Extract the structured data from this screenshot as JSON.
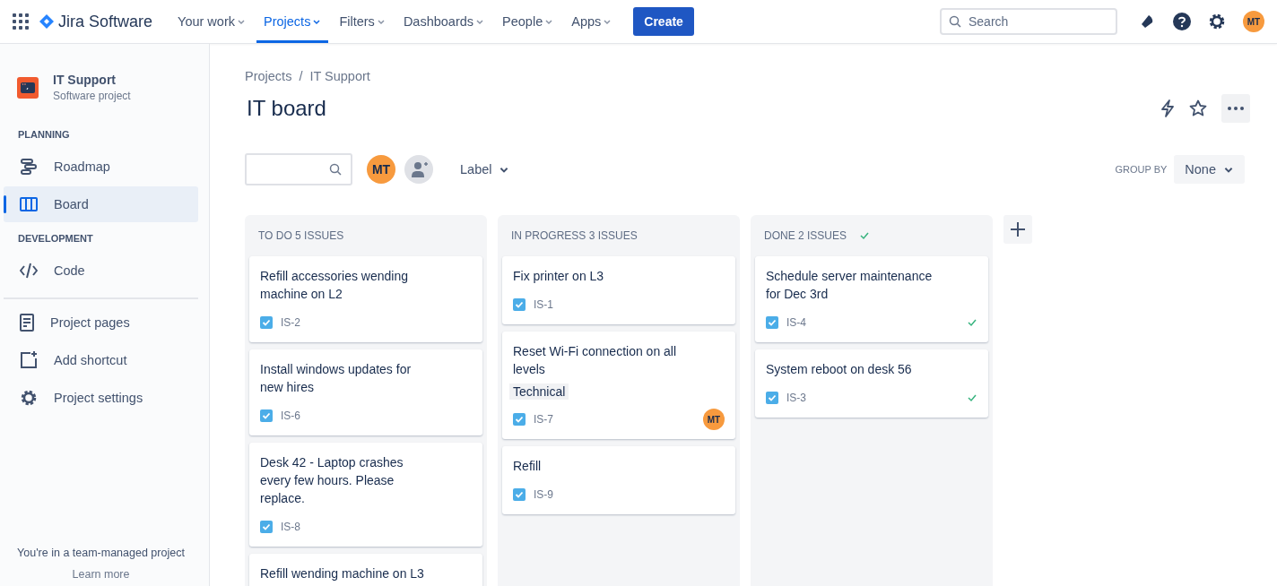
{
  "topbar": {
    "product": "Jira Software",
    "nav": [
      {
        "label": "Your work",
        "selected": false
      },
      {
        "label": "Projects",
        "selected": true
      },
      {
        "label": "Filters",
        "selected": false
      },
      {
        "label": "Dashboards",
        "selected": false
      },
      {
        "label": "People",
        "selected": false
      },
      {
        "label": "Apps",
        "selected": false
      }
    ],
    "create": "Create",
    "search": {
      "placeholder": "Search"
    },
    "avatar": "MT"
  },
  "sidebar": {
    "project": {
      "name": "IT Support",
      "type": "Software project"
    },
    "sections": [
      {
        "heading": "PLANNING",
        "items": [
          {
            "label": "Roadmap",
            "kind": "roadmap",
            "selected": false
          },
          {
            "label": "Board",
            "kind": "board",
            "selected": true
          }
        ]
      },
      {
        "heading": "DEVELOPMENT",
        "items": [
          {
            "label": "Code",
            "kind": "code",
            "selected": false
          }
        ]
      }
    ],
    "links": [
      {
        "label": "Project pages",
        "kind": "pages"
      },
      {
        "label": "Add shortcut",
        "kind": "shortcut"
      },
      {
        "label": "Project settings",
        "kind": "settings"
      }
    ],
    "footer": {
      "text": "You're in a team-managed project",
      "link": "Learn more"
    }
  },
  "breadcrumbs": {
    "items": [
      "Projects",
      "IT Support"
    ],
    "separator": "/"
  },
  "title": "IT board",
  "filters": {
    "avatar": "MT",
    "label_filter": "Label",
    "group_by": {
      "label": "GROUP BY",
      "value": "None"
    }
  },
  "columns": [
    {
      "title": "TO DO 5 ISSUES",
      "done": false,
      "cards": [
        {
          "title": "Refill accessories wending machine on L2",
          "key": "IS-2",
          "done": false
        },
        {
          "title": "Install windows updates for new hires",
          "key": "IS-6",
          "done": false
        },
        {
          "title": "Desk 42 - Laptop crashes every few hours. Please replace.",
          "key": "IS-8",
          "done": false
        },
        {
          "title": "Refill wending machine on L3"
        }
      ]
    },
    {
      "title": "IN PROGRESS 3 ISSUES",
      "done": false,
      "cards": [
        {
          "title": "Fix printer on L3",
          "key": "IS-1",
          "done": false
        },
        {
          "title": "Reset Wi-Fi connection on all levels",
          "label": "Technical",
          "key": "IS-7",
          "assignee": "MT",
          "done": false
        },
        {
          "title": "Refill",
          "key": "IS-9",
          "done": false
        }
      ]
    },
    {
      "title": "DONE 2 ISSUES",
      "done": true,
      "cards": [
        {
          "title": "Schedule server maintenance for Dec 3rd",
          "key": "IS-4",
          "done": true
        },
        {
          "title": "System reboot on desk 56",
          "key": "IS-3",
          "done": true
        }
      ]
    }
  ]
}
